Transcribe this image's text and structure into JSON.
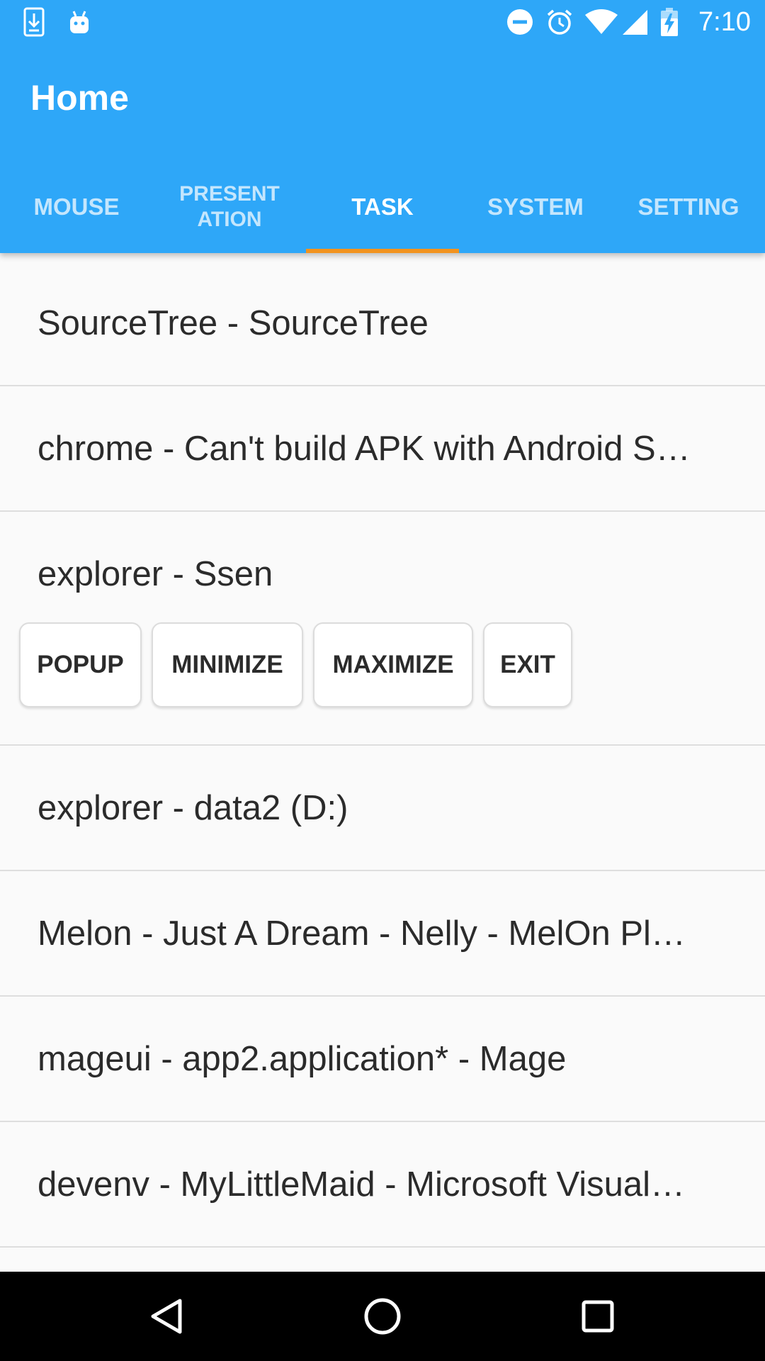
{
  "status_bar": {
    "time": "7:10",
    "icons": [
      "download-icon",
      "android-icon",
      "do-not-disturb-icon",
      "alarm-icon",
      "wifi-icon",
      "cell-signal-icon",
      "battery-charging-icon"
    ]
  },
  "app_bar": {
    "title": "Home"
  },
  "tabs": [
    {
      "label": "MOUSE",
      "active": false
    },
    {
      "label": "PRESENT\nATION",
      "active": false
    },
    {
      "label": "TASK",
      "active": true
    },
    {
      "label": "SYSTEM",
      "active": false
    },
    {
      "label": "SETTING",
      "active": false
    }
  ],
  "tasks": [
    {
      "label": "SourceTree - SourceTree"
    },
    {
      "label": "chrome - Can't build APK with Android S…"
    },
    {
      "label": "explorer - Ssen"
    },
    {
      "label": "explorer - data2 (D:)"
    },
    {
      "label": "Melon - Just A Dream - Nelly - MelOn Pl…"
    },
    {
      "label": "mageui - app2.application* - Mage"
    },
    {
      "label": "devenv - MyLittleMaid - Microsoft Visual…"
    }
  ],
  "task_actions": {
    "popup": "POPUP",
    "minimize": "MINIMIZE",
    "maximize": "MAXIMIZE",
    "exit": "EXIT"
  },
  "colors": {
    "app_bar": "#2ea7f8",
    "tab_indicator": "#f2931e",
    "nav_bar": "#000000"
  }
}
